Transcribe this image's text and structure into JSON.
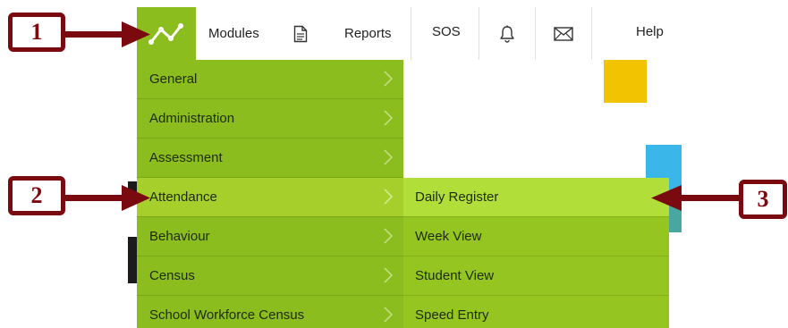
{
  "topbar": {
    "modules_label": "Modules",
    "reports_label": "Reports",
    "sos_label": "SOS",
    "help_label": "Help"
  },
  "menu": {
    "items": [
      {
        "label": "General"
      },
      {
        "label": "Administration"
      },
      {
        "label": "Assessment"
      },
      {
        "label": "Attendance"
      },
      {
        "label": "Behaviour"
      },
      {
        "label": "Census"
      },
      {
        "label": "School Workforce Census"
      }
    ],
    "active_item": "Attendance"
  },
  "submenu": {
    "items": [
      {
        "label": "Daily Register"
      },
      {
        "label": "Week View"
      },
      {
        "label": "Student View"
      },
      {
        "label": "Speed Entry"
      }
    ],
    "active_item": "Daily Register"
  },
  "callouts": {
    "one": "1",
    "two": "2",
    "three": "3"
  },
  "colors": {
    "menu_green": "#8bbd1e",
    "active_green": "#a6cf2b",
    "submenu_green": "#95c521",
    "callout_red": "#7b0a10",
    "tile_yellow": "#f2c300",
    "tile_blue": "#3bb6e8"
  },
  "icons": {
    "logo": "line-graph-icon",
    "reports": "document-icon",
    "notifications": "bell-icon",
    "messages": "envelope-icon",
    "chevron": "chevron-right-icon"
  }
}
